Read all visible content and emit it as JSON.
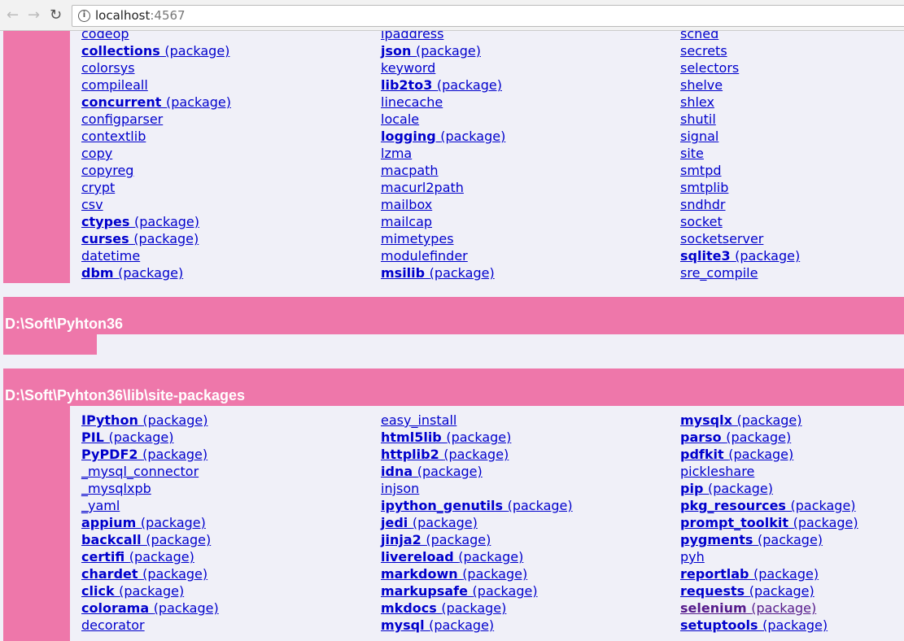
{
  "browser": {
    "url_host": "localhost",
    "url_port": ":4567",
    "back_icon": "arrow-left-icon",
    "forward_icon": "arrow-right-icon",
    "reload_icon": "reload-icon",
    "info_icon": "info-icon"
  },
  "colors": {
    "section_bg": "#ee77aa",
    "page_bg": "#f0f0f8",
    "link": "#0000cc",
    "visited": "#551a8b"
  },
  "package_suffix": "(package)",
  "sections": [
    {
      "title": "",
      "columns": [
        [
          [
            "codeop",
            0
          ],
          [
            "collections",
            1
          ],
          [
            "colorsys",
            0
          ],
          [
            "compileall",
            0
          ],
          [
            "concurrent",
            1
          ],
          [
            "configparser",
            0
          ],
          [
            "contextlib",
            0
          ],
          [
            "copy",
            0
          ],
          [
            "copyreg",
            0
          ],
          [
            "crypt",
            0
          ],
          [
            "csv",
            0
          ],
          [
            "ctypes",
            1
          ],
          [
            "curses",
            1
          ],
          [
            "datetime",
            0
          ],
          [
            "dbm",
            1
          ]
        ],
        [
          [
            "ipaddress",
            0
          ],
          [
            "json",
            1
          ],
          [
            "keyword",
            0
          ],
          [
            "lib2to3",
            1
          ],
          [
            "linecache",
            0
          ],
          [
            "locale",
            0
          ],
          [
            "logging",
            1
          ],
          [
            "lzma",
            0
          ],
          [
            "macpath",
            0
          ],
          [
            "macurl2path",
            0
          ],
          [
            "mailbox",
            0
          ],
          [
            "mailcap",
            0
          ],
          [
            "mimetypes",
            0
          ],
          [
            "modulefinder",
            0
          ],
          [
            "msilib",
            1
          ]
        ],
        [
          [
            "sched",
            0
          ],
          [
            "secrets",
            0
          ],
          [
            "selectors",
            0
          ],
          [
            "shelve",
            0
          ],
          [
            "shlex",
            0
          ],
          [
            "shutil",
            0
          ],
          [
            "signal",
            0
          ],
          [
            "site",
            0
          ],
          [
            "smtpd",
            0
          ],
          [
            "smtplib",
            0
          ],
          [
            "sndhdr",
            0
          ],
          [
            "socket",
            0
          ],
          [
            "socketserver",
            0
          ],
          [
            "sqlite3",
            1
          ],
          [
            "sre_compile",
            0
          ]
        ]
      ]
    },
    {
      "title": "D:\\Soft\\Pyhton36",
      "columns": []
    },
    {
      "title": "D:\\Soft\\Pyhton36\\lib\\site-packages",
      "columns": [
        [
          [
            "IPython",
            1
          ],
          [
            "PIL",
            1
          ],
          [
            "PyPDF2",
            1
          ],
          [
            "_mysql_connector",
            0
          ],
          [
            "_mysqlxpb",
            0
          ],
          [
            "_yaml",
            0
          ],
          [
            "appium",
            1
          ],
          [
            "backcall",
            1
          ],
          [
            "certifi",
            1
          ],
          [
            "chardet",
            1
          ],
          [
            "click",
            1
          ],
          [
            "colorama",
            1
          ],
          [
            "decorator",
            0
          ]
        ],
        [
          [
            "easy_install",
            0
          ],
          [
            "html5lib",
            1
          ],
          [
            "httplib2",
            1
          ],
          [
            "idna",
            1
          ],
          [
            "injson",
            0
          ],
          [
            "ipython_genutils",
            1
          ],
          [
            "jedi",
            1
          ],
          [
            "jinja2",
            1
          ],
          [
            "livereload",
            1
          ],
          [
            "markdown",
            1
          ],
          [
            "markupsafe",
            1
          ],
          [
            "mkdocs",
            1
          ],
          [
            "mysql",
            1
          ]
        ],
        [
          [
            "mysqlx",
            1
          ],
          [
            "parso",
            1
          ],
          [
            "pdfkit",
            1
          ],
          [
            "pickleshare",
            0
          ],
          [
            "pip",
            1
          ],
          [
            "pkg_resources",
            1
          ],
          [
            "prompt_toolkit",
            1
          ],
          [
            "pygments",
            1
          ],
          [
            "pyh",
            0
          ],
          [
            "reportlab",
            1
          ],
          [
            "requests",
            1
          ],
          [
            "selenium",
            2
          ],
          [
            "setuptools",
            1
          ]
        ]
      ]
    }
  ]
}
